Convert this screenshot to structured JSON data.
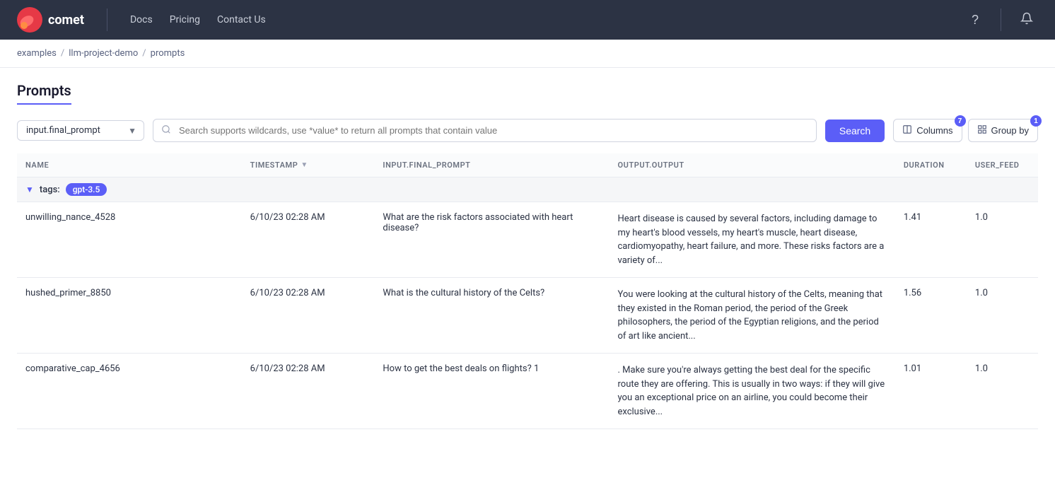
{
  "navbar": {
    "brand": "comet",
    "links": [
      {
        "label": "Docs",
        "id": "docs"
      },
      {
        "label": "Pricing",
        "id": "pricing"
      },
      {
        "label": "Contact Us",
        "id": "contact-us"
      }
    ],
    "icons": {
      "help": "?",
      "notifications": "🔔"
    }
  },
  "breadcrumb": {
    "parts": [
      {
        "label": "examples",
        "id": "bc-examples"
      },
      {
        "label": "llm-project-demo",
        "id": "bc-project"
      },
      {
        "label": "prompts",
        "id": "bc-prompts"
      }
    ]
  },
  "page": {
    "title": "Prompts"
  },
  "toolbar": {
    "dropdown_value": "input.final_prompt",
    "search_placeholder": "Search supports wildcards, use *value* to return all prompts that contain value",
    "search_label": "Search",
    "columns_label": "Columns",
    "columns_badge": "7",
    "groupby_label": "Group by",
    "groupby_badge": "1"
  },
  "table": {
    "columns": [
      {
        "label": "NAME",
        "id": "col-name",
        "sortable": false
      },
      {
        "label": "TIMESTAMP",
        "id": "col-timestamp",
        "sortable": true
      },
      {
        "label": "INPUT.FINAL_PROMPT",
        "id": "col-prompt",
        "sortable": false
      },
      {
        "label": "OUTPUT.OUTPUT",
        "id": "col-output",
        "sortable": false
      },
      {
        "label": "DURATION",
        "id": "col-duration",
        "sortable": false
      },
      {
        "label": "USER_FEED",
        "id": "col-feed",
        "sortable": false
      }
    ],
    "groups": [
      {
        "label": "tags:",
        "tag": "gpt-3.5",
        "rows": [
          {
            "name": "unwilling_nance_4528",
            "timestamp": "6/10/23 02:28 AM",
            "prompt": "What are the risk factors associated with heart disease?",
            "output": "Heart disease is caused by several factors, including damage to my heart's blood vessels, my heart's muscle, heart disease, cardiomyopathy, heart failure, and more. These risks factors are a variety of...",
            "duration": "1.41",
            "feed": "1.0"
          },
          {
            "name": "hushed_primer_8850",
            "timestamp": "6/10/23 02:28 AM",
            "prompt": "What is the cultural history of the Celts?",
            "output": "You were looking at the cultural history of the Celts, meaning that they existed in the Roman period, the period of the Greek philosophers, the period of the Egyptian religions, and the period of art like ancient...",
            "duration": "1.56",
            "feed": "1.0"
          },
          {
            "name": "comparative_cap_4656",
            "timestamp": "6/10/23 02:28 AM",
            "prompt": "How to get the best deals on flights? 1",
            "output": ". Make sure you're always getting the best deal for the specific route they are offering. This is usually in two ways: if they will give you an exceptional price on an airline, you could become their exclusive...",
            "duration": "1.01",
            "feed": "1.0"
          }
        ]
      }
    ]
  }
}
